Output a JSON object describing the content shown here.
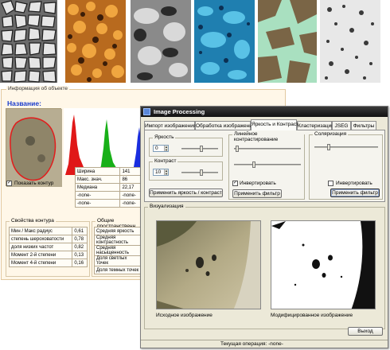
{
  "back_window": {
    "legend": "Информация об объекте",
    "name_label": "Название:",
    "show_contour_label": "Показать контур",
    "stats": [
      {
        "label": "Ширина",
        "value": "141"
      },
      {
        "label": "Макс. знач.",
        "value": "86"
      },
      {
        "label": "Медиана",
        "value": "22,17"
      },
      {
        "label": "-none-",
        "value": "-none-"
      },
      {
        "label": "-none-",
        "value": "-none-"
      }
    ],
    "contour_group": {
      "title": "Свойства контура",
      "rows": [
        {
          "label": "Мин / Макс радиус",
          "value": "0,61"
        },
        {
          "label": "степень шероховатости",
          "value": "0,78"
        },
        {
          "label": "доля низких частот",
          "value": "0,82"
        },
        {
          "label": "Момент 2-й степени",
          "value": "0,13"
        },
        {
          "label": "Момент 4-й степени",
          "value": "0,16"
        }
      ]
    },
    "spatial_group": {
      "title": "Общие пространственн",
      "rows": [
        {
          "label": "Средняя яркость"
        },
        {
          "label": "Средняя контрастность"
        },
        {
          "label": "Средняя насыщенность"
        },
        {
          "label": "Доля светлых точек"
        },
        {
          "label": "Доля темных точек"
        }
      ]
    }
  },
  "window": {
    "title": "Image Processing",
    "tabs": [
      {
        "label": "Импорт изображения"
      },
      {
        "label": "Обработка изображения"
      },
      {
        "label": "Яркость и Контраст"
      },
      {
        "label": "Кластеризация"
      },
      {
        "label": "JSEG"
      },
      {
        "label": "Фильтры"
      }
    ],
    "active_tab": "Яркость и Контраст",
    "brightness": {
      "title": "Яркость",
      "value": "0",
      "slider_level": 0.55
    },
    "contrast": {
      "title": "Контраст",
      "value": "10",
      "slider_level": 0.55
    },
    "apply_bc_button": "Применить яркость / контраст",
    "linear": {
      "title": "Линейное контрастирование",
      "slider1_level": 0.05,
      "slider2_level": 0.3,
      "invert_label": "Инвертировать",
      "invert_checked": true,
      "apply_button": "Применить фильтр"
    },
    "solarization": {
      "title": "Соляризация",
      "slider_level": 0.22,
      "invert_label": "Инвертировать",
      "invert_checked": false,
      "apply_button": "Применить фильтр"
    },
    "visualization": {
      "title": "Визуализация",
      "source_caption": "Исходное изображение",
      "modified_caption": "Модифицированное изображение"
    },
    "exit_button": "Выход",
    "status_text": "Текущая операция: -none-"
  }
}
